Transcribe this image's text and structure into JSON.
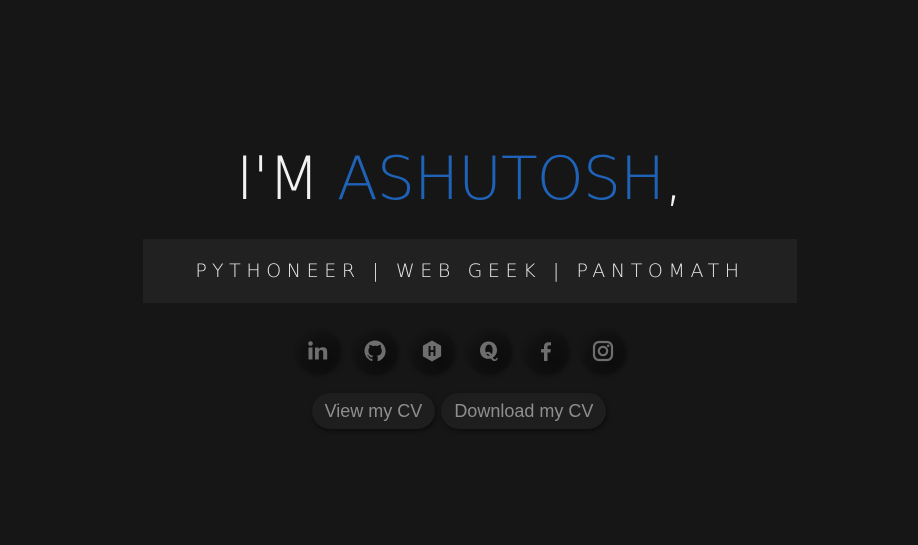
{
  "hero": {
    "greeting_prefix": "I'M",
    "name": "ASHUTOSH",
    "greeting_suffix": ",",
    "name_color": "#1e63b8"
  },
  "tagline": "PYTHONEER | WEB GEEK | PANTOMATH",
  "social_links": [
    {
      "icon": "linkedin-icon"
    },
    {
      "icon": "github-icon"
    },
    {
      "icon": "hackerrank-icon"
    },
    {
      "icon": "quora-icon"
    },
    {
      "icon": "facebook-icon"
    },
    {
      "icon": "instagram-icon"
    }
  ],
  "cv_buttons": {
    "view": "View my CV",
    "download": "Download my CV"
  },
  "colors": {
    "background": "#161616",
    "tagline_box": "#212121",
    "icon": "#6e6e6e",
    "button_text": "#8e8e8e"
  }
}
